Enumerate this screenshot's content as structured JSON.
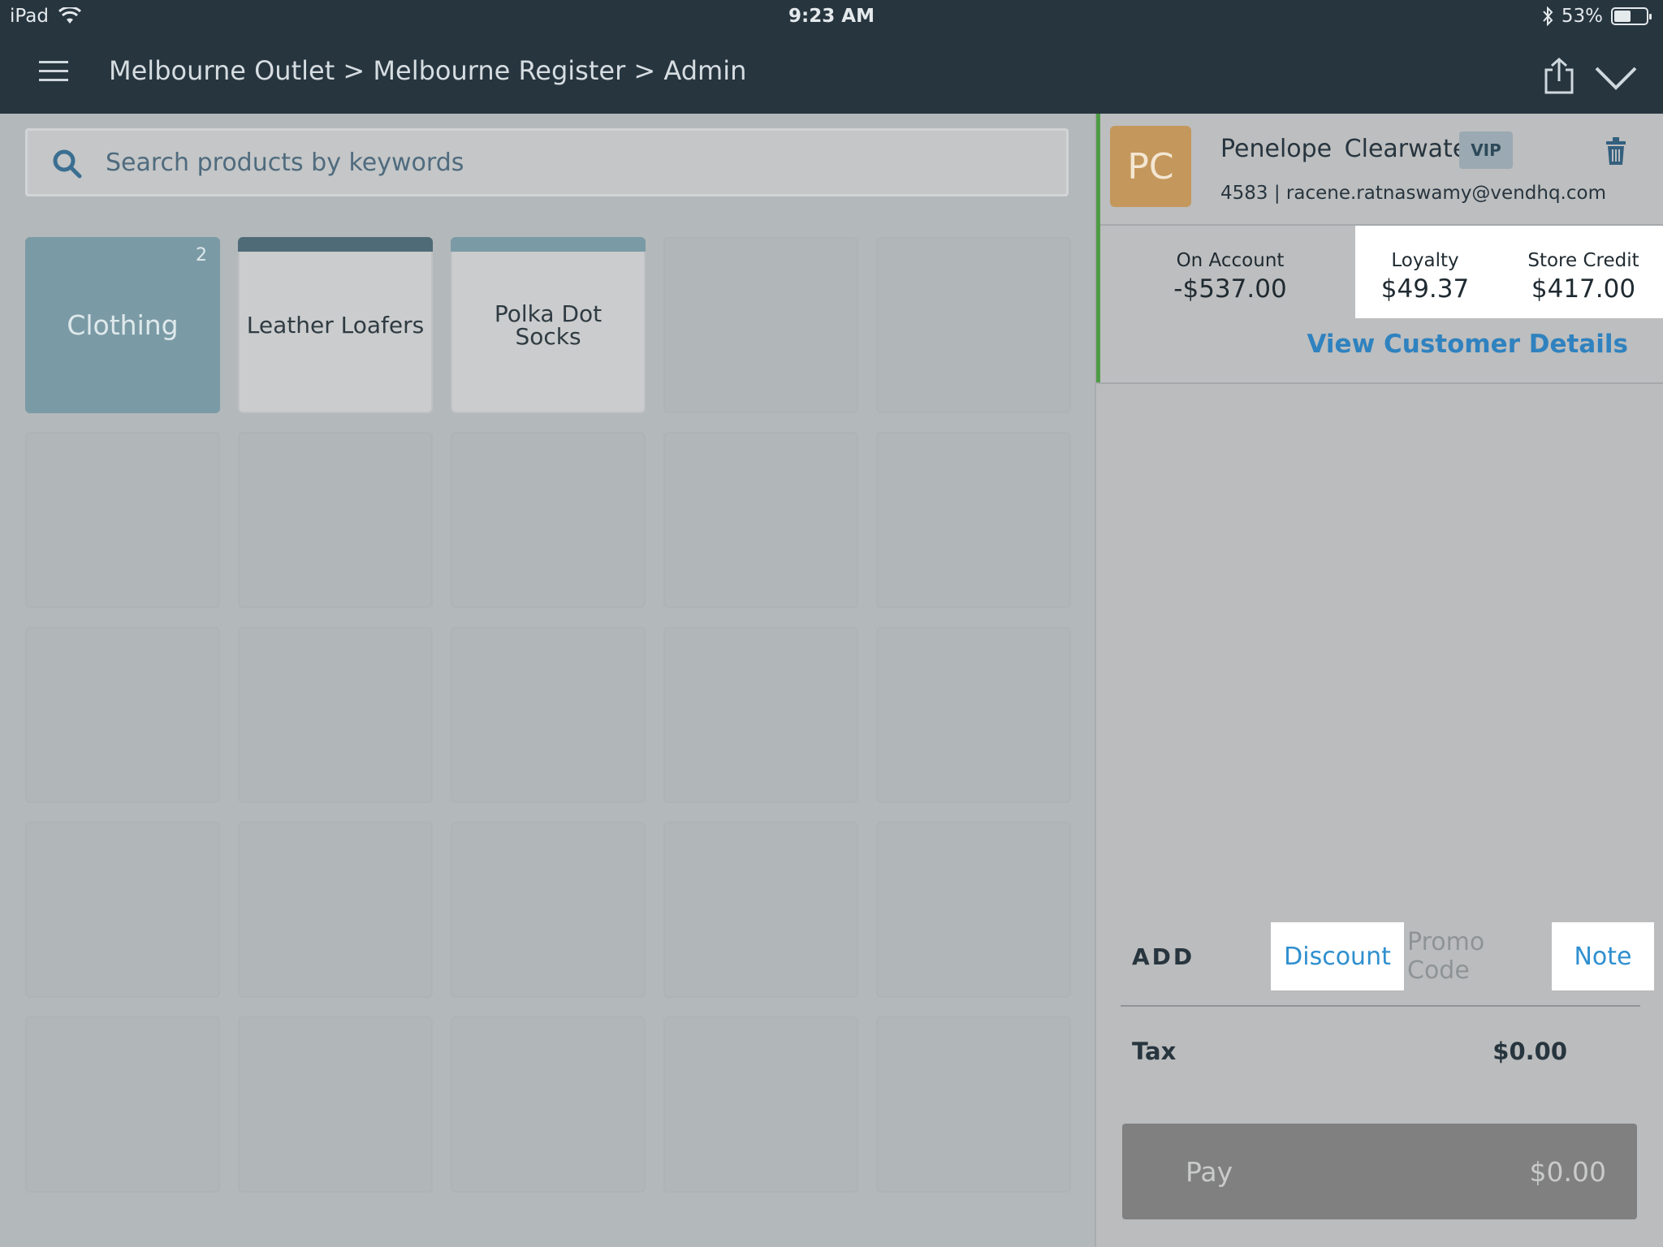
{
  "status_bar": {
    "device": "iPad",
    "time": "9:23 AM",
    "battery_text": "53%",
    "battery_level": 0.53
  },
  "header": {
    "breadcrumb": "Melbourne Outlet > Melbourne Register > Admin"
  },
  "search": {
    "placeholder": "Search products by keywords"
  },
  "tiles": [
    {
      "label": "Clothing",
      "count": "2",
      "kind": "category"
    },
    {
      "label": "Leather Loafers",
      "kind": "product",
      "color": "#506b78"
    },
    {
      "label": "Polka Dot Socks",
      "kind": "product",
      "color": "#7a9ba5"
    }
  ],
  "customer": {
    "initials": "PC",
    "name": "Penelope  Clearwater",
    "badge": "VIP",
    "meta": "4583 | racene.ratnaswamy@vendhq.com",
    "on_account_label": "On Account",
    "on_account_value": "-$537.00",
    "loyalty_label": "Loyalty",
    "loyalty_value": "$49.37",
    "store_credit_label": "Store Credit",
    "store_credit_value": "$417.00",
    "details_link": "View Customer Details"
  },
  "sale": {
    "add_label": "ADD",
    "discount": "Discount",
    "promo": "Promo Code",
    "note": "Note",
    "tax_label": "Tax",
    "tax_value": "$0.00",
    "pay_label": "Pay",
    "pay_value": "$0.00"
  },
  "colors": {
    "header_bg": "#27353f",
    "accent_blue": "#2f82bf",
    "avatar": "#c4975c",
    "customer_stripe": "#4e9b45"
  }
}
